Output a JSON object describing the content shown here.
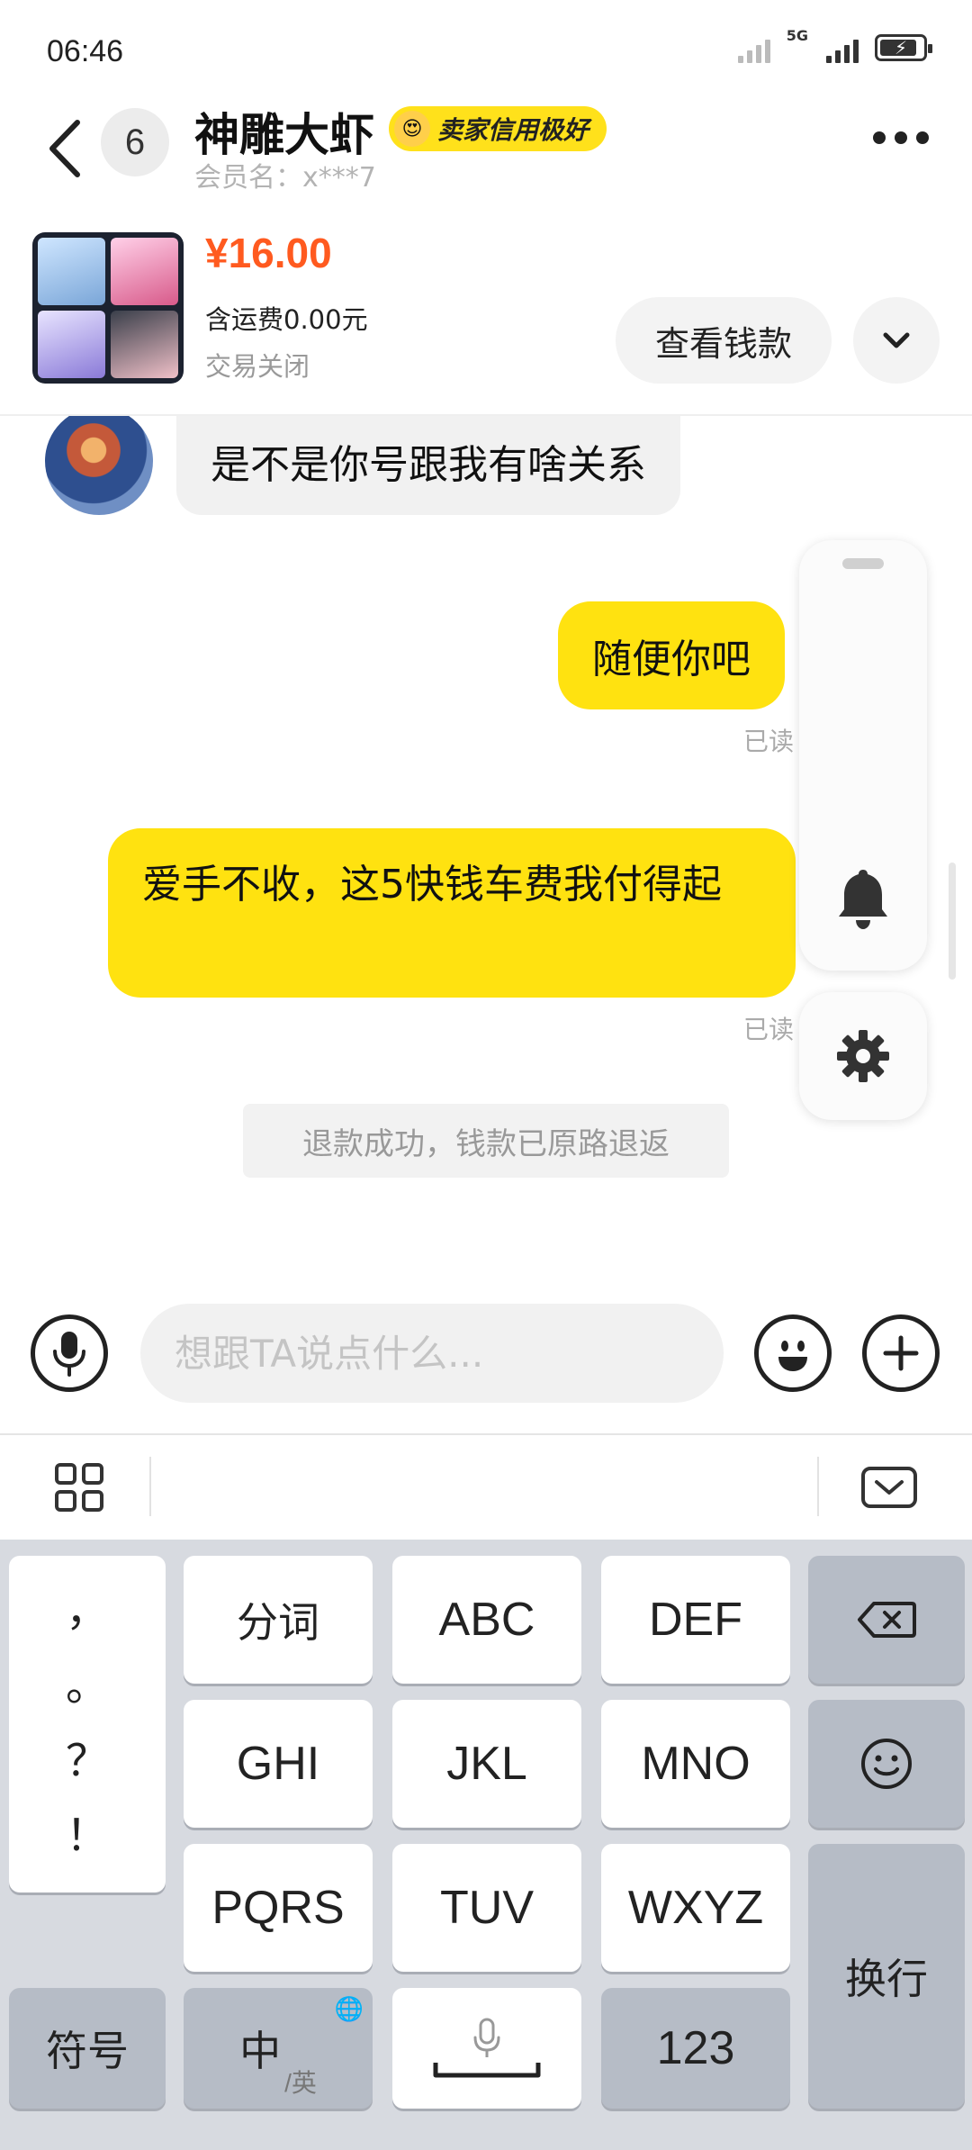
{
  "status_bar": {
    "time": "06:46",
    "network": "5G"
  },
  "header": {
    "unread_count": "6",
    "seller_name": "神雕大虾",
    "credit_badge": "卖家信用极好",
    "member_name": "会员名：x***7"
  },
  "product": {
    "price": "¥16.00",
    "shipping": "含运费0.00元",
    "status": "交易关闭",
    "view_payment_label": "查看钱款"
  },
  "messages": [
    {
      "direction": "in",
      "text": "是不是你号跟我有啥关系"
    },
    {
      "direction": "out",
      "text": "随便你吧",
      "read_status": "已读"
    },
    {
      "direction": "out",
      "text": "爱手不收，这5快钱车费我付得起",
      "read_status": "已读"
    },
    {
      "direction": "system",
      "text": "退款成功，钱款已原路退返"
    }
  ],
  "input_bar": {
    "placeholder": "想跟TA说点什么..."
  },
  "keyboard": {
    "punctuation": [
      "，",
      "。",
      "？",
      "！"
    ],
    "row1": [
      "分词",
      "ABC",
      "DEF"
    ],
    "row2": [
      "GHI",
      "JKL",
      "MNO"
    ],
    "row3": [
      "PQRS",
      "TUV",
      "WXYZ"
    ],
    "symbols_label": "符号",
    "lang_main": "中",
    "lang_sub": "/英",
    "numbers_label": "123",
    "enter_label": "换行"
  },
  "colors": {
    "accent_yellow": "#ffe210",
    "price_orange": "#ff5a1f"
  }
}
